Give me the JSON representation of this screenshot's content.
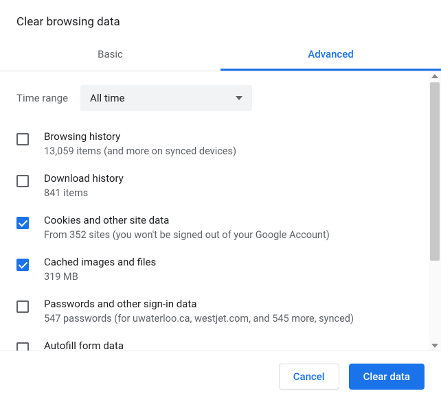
{
  "dialog": {
    "title": "Clear browsing data"
  },
  "tabs": {
    "basic": "Basic",
    "advanced": "Advanced"
  },
  "time_range": {
    "label": "Time range",
    "selected": "All time"
  },
  "items": [
    {
      "checked": false,
      "title": "Browsing history",
      "sub": "13,059 items (and more on synced devices)"
    },
    {
      "checked": false,
      "title": "Download history",
      "sub": "841 items"
    },
    {
      "checked": true,
      "title": "Cookies and other site data",
      "sub": "From 352 sites (you won't be signed out of your Google Account)"
    },
    {
      "checked": true,
      "title": "Cached images and files",
      "sub": "319 MB"
    },
    {
      "checked": false,
      "title": "Passwords and other sign-in data",
      "sub": "547 passwords (for uwaterloo.ca, westjet.com, and 545 more, synced)"
    },
    {
      "checked": false,
      "title": "Autofill form data",
      "sub": ""
    }
  ],
  "footer": {
    "cancel": "Cancel",
    "confirm": "Clear data"
  }
}
